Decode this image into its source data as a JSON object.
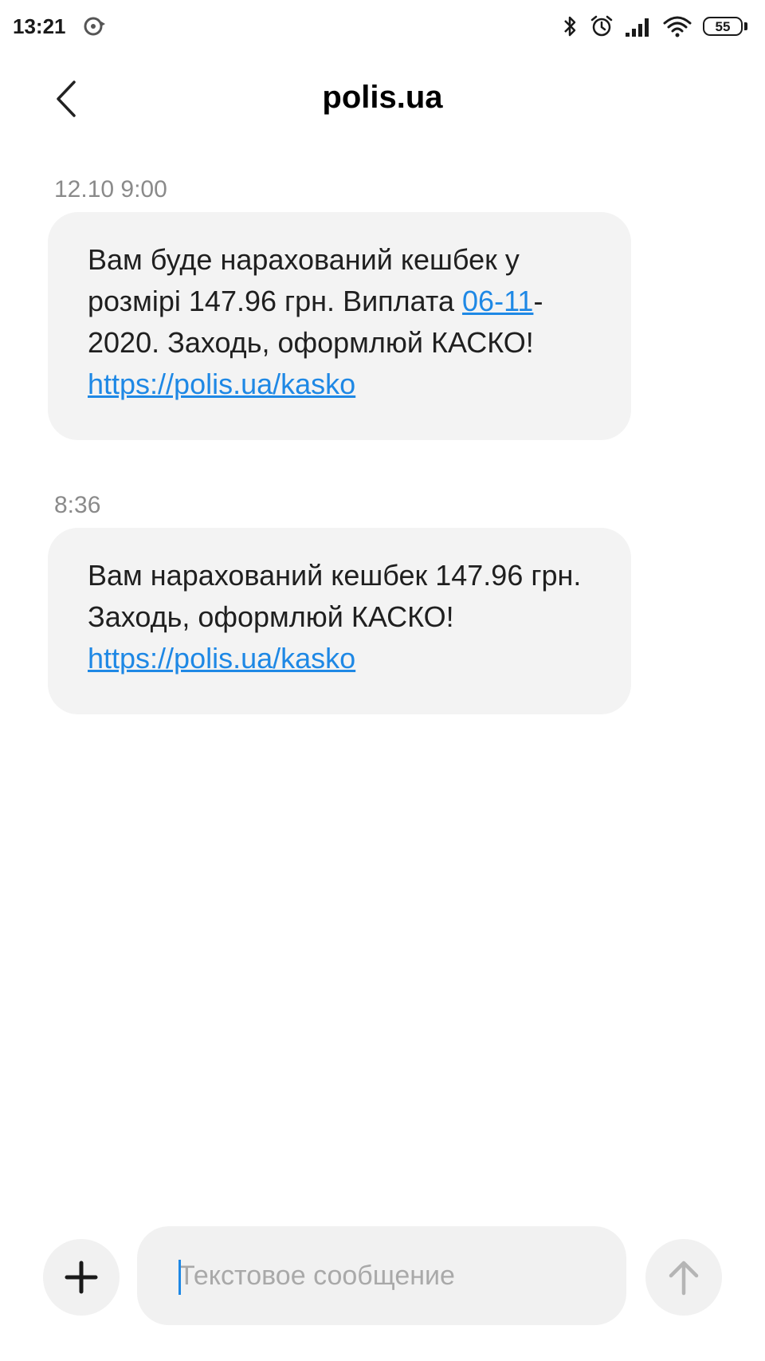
{
  "status_bar": {
    "time": "13:21",
    "battery": "55",
    "icons": [
      "sync-icon",
      "bluetooth-icon",
      "alarm-icon",
      "signal-icon",
      "wifi-icon",
      "battery-icon"
    ]
  },
  "header": {
    "title": "polis.ua",
    "back_icon": "chevron-left-icon"
  },
  "messages": [
    {
      "time": "12.10 9:00",
      "text_part1": "Вам буде нарахований кешбек у розмірі 147.96 грн. Виплата ",
      "date_link": "06-11",
      "text_part2": "-2020. Заходь, оформлюй КАСКО! ",
      "url": "https://polis.ua/kasko"
    },
    {
      "time": "8:36",
      "text_part1": "Вам нарахований кешбек 147.96 грн. Заходь, оформлюй КАСКО! ",
      "url": "https://polis.ua/kasko"
    }
  ],
  "composer": {
    "placeholder": "Текстовое сообщение",
    "add_icon": "plus-icon",
    "send_icon": "arrow-up-icon"
  },
  "colors": {
    "link": "#1e88e5",
    "bubble": "#f3f3f3",
    "timestamp": "#8a8a8a"
  }
}
